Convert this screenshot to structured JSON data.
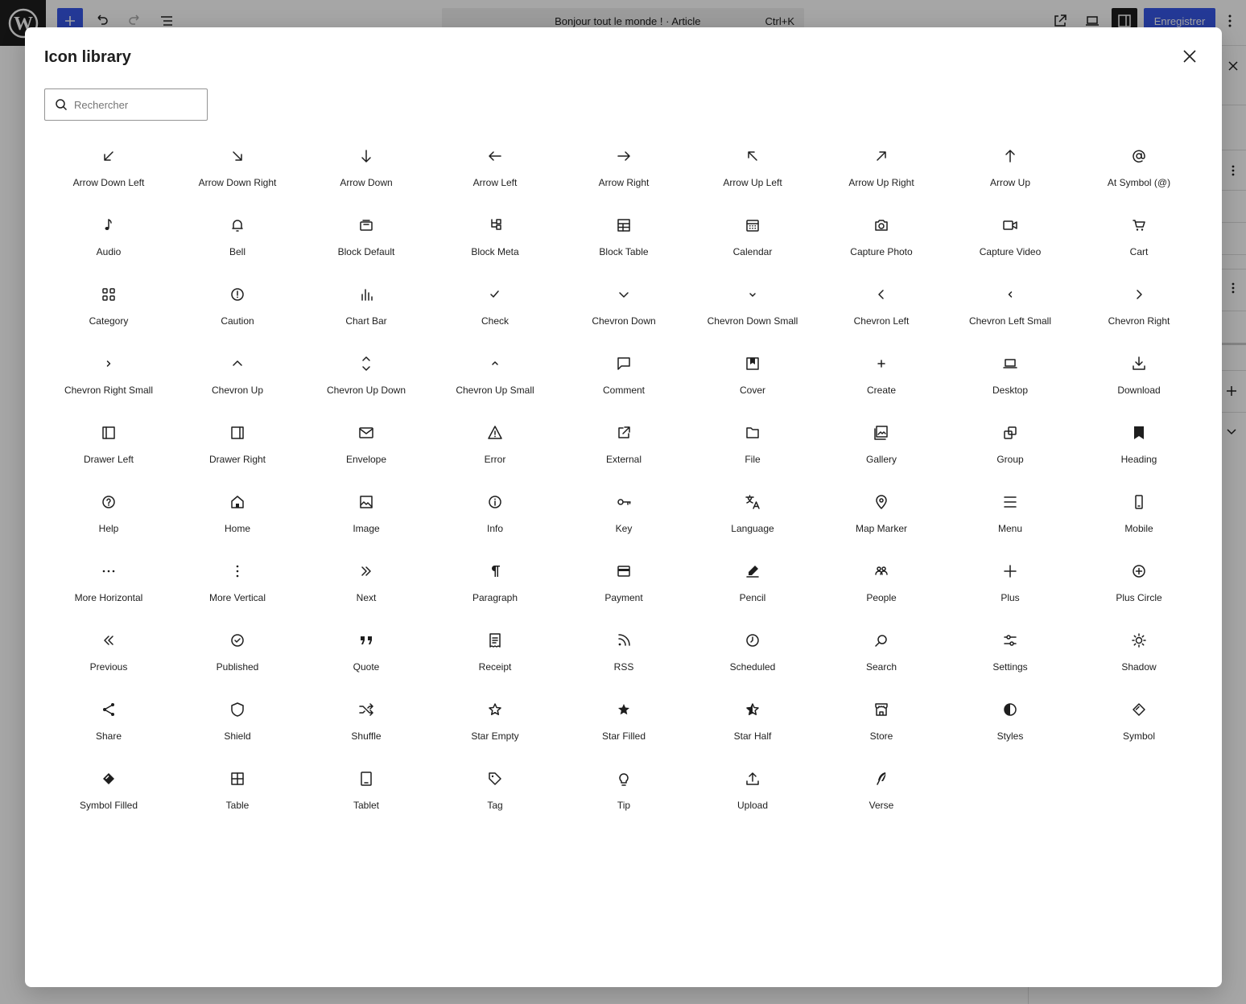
{
  "editor": {
    "document_title": "Bonjour tout le monde ! · Article",
    "shortcut": "Ctrl+K",
    "save_label": "Enregistrer"
  },
  "modal": {
    "title": "Icon library",
    "search": {
      "placeholder": "Rechercher",
      "value": ""
    }
  },
  "icons": [
    {
      "label": "Arrow Down Left",
      "icon": "arrow-down-left-icon"
    },
    {
      "label": "Arrow Down Right",
      "icon": "arrow-down-right-icon"
    },
    {
      "label": "Arrow Down",
      "icon": "arrow-down-icon"
    },
    {
      "label": "Arrow Left",
      "icon": "arrow-left-icon"
    },
    {
      "label": "Arrow Right",
      "icon": "arrow-right-icon"
    },
    {
      "label": "Arrow Up Left",
      "icon": "arrow-up-left-icon"
    },
    {
      "label": "Arrow Up Right",
      "icon": "arrow-up-right-icon"
    },
    {
      "label": "Arrow Up",
      "icon": "arrow-up-icon"
    },
    {
      "label": "At Symbol (@)",
      "icon": "at-symbol-icon"
    },
    {
      "label": "Audio",
      "icon": "audio-icon"
    },
    {
      "label": "Bell",
      "icon": "bell-icon"
    },
    {
      "label": "Block Default",
      "icon": "block-default-icon"
    },
    {
      "label": "Block Meta",
      "icon": "block-meta-icon"
    },
    {
      "label": "Block Table",
      "icon": "block-table-icon"
    },
    {
      "label": "Calendar",
      "icon": "calendar-icon"
    },
    {
      "label": "Capture Photo",
      "icon": "capture-photo-icon"
    },
    {
      "label": "Capture Video",
      "icon": "capture-video-icon"
    },
    {
      "label": "Cart",
      "icon": "cart-icon"
    },
    {
      "label": "Category",
      "icon": "category-icon"
    },
    {
      "label": "Caution",
      "icon": "caution-icon"
    },
    {
      "label": "Chart Bar",
      "icon": "chart-bar-icon"
    },
    {
      "label": "Check",
      "icon": "check-icon"
    },
    {
      "label": "Chevron Down",
      "icon": "chevron-down-icon"
    },
    {
      "label": "Chevron Down Small",
      "icon": "chevron-down-small-icon"
    },
    {
      "label": "Chevron Left",
      "icon": "chevron-left-icon"
    },
    {
      "label": "Chevron Left Small",
      "icon": "chevron-left-small-icon"
    },
    {
      "label": "Chevron Right",
      "icon": "chevron-right-icon"
    },
    {
      "label": "Chevron Right Small",
      "icon": "chevron-right-small-icon"
    },
    {
      "label": "Chevron Up",
      "icon": "chevron-up-icon"
    },
    {
      "label": "Chevron Up Down",
      "icon": "chevron-up-down-icon"
    },
    {
      "label": "Chevron Up Small",
      "icon": "chevron-up-small-icon"
    },
    {
      "label": "Comment",
      "icon": "comment-icon"
    },
    {
      "label": "Cover",
      "icon": "cover-icon"
    },
    {
      "label": "Create",
      "icon": "create-icon"
    },
    {
      "label": "Desktop",
      "icon": "desktop-icon"
    },
    {
      "label": "Download",
      "icon": "download-icon"
    },
    {
      "label": "Drawer Left",
      "icon": "drawer-left-icon"
    },
    {
      "label": "Drawer Right",
      "icon": "drawer-right-icon"
    },
    {
      "label": "Envelope",
      "icon": "envelope-icon"
    },
    {
      "label": "Error",
      "icon": "error-icon"
    },
    {
      "label": "External",
      "icon": "external-icon"
    },
    {
      "label": "File",
      "icon": "file-icon"
    },
    {
      "label": "Gallery",
      "icon": "gallery-icon"
    },
    {
      "label": "Group",
      "icon": "group-icon"
    },
    {
      "label": "Heading",
      "icon": "heading-icon"
    },
    {
      "label": "Help",
      "icon": "help-icon"
    },
    {
      "label": "Home",
      "icon": "home-icon"
    },
    {
      "label": "Image",
      "icon": "image-icon"
    },
    {
      "label": "Info",
      "icon": "info-icon"
    },
    {
      "label": "Key",
      "icon": "key-icon"
    },
    {
      "label": "Language",
      "icon": "language-icon"
    },
    {
      "label": "Map Marker",
      "icon": "map-marker-icon"
    },
    {
      "label": "Menu",
      "icon": "menu-icon"
    },
    {
      "label": "Mobile",
      "icon": "mobile-icon"
    },
    {
      "label": "More Horizontal",
      "icon": "more-horizontal-icon"
    },
    {
      "label": "More Vertical",
      "icon": "more-vertical-icon"
    },
    {
      "label": "Next",
      "icon": "next-icon"
    },
    {
      "label": "Paragraph",
      "icon": "paragraph-icon"
    },
    {
      "label": "Payment",
      "icon": "payment-icon"
    },
    {
      "label": "Pencil",
      "icon": "pencil-icon"
    },
    {
      "label": "People",
      "icon": "people-icon"
    },
    {
      "label": "Plus",
      "icon": "plus-icon"
    },
    {
      "label": "Plus Circle",
      "icon": "plus-circle-icon"
    },
    {
      "label": "Previous",
      "icon": "previous-icon"
    },
    {
      "label": "Published",
      "icon": "published-icon"
    },
    {
      "label": "Quote",
      "icon": "quote-icon"
    },
    {
      "label": "Receipt",
      "icon": "receipt-icon"
    },
    {
      "label": "RSS",
      "icon": "rss-icon"
    },
    {
      "label": "Scheduled",
      "icon": "scheduled-icon"
    },
    {
      "label": "Search",
      "icon": "search-icon"
    },
    {
      "label": "Settings",
      "icon": "settings-icon"
    },
    {
      "label": "Shadow",
      "icon": "shadow-icon"
    },
    {
      "label": "Share",
      "icon": "share-icon"
    },
    {
      "label": "Shield",
      "icon": "shield-icon"
    },
    {
      "label": "Shuffle",
      "icon": "shuffle-icon"
    },
    {
      "label": "Star Empty",
      "icon": "star-empty-icon"
    },
    {
      "label": "Star Filled",
      "icon": "star-filled-icon"
    },
    {
      "label": "Star Half",
      "icon": "star-half-icon"
    },
    {
      "label": "Store",
      "icon": "store-icon"
    },
    {
      "label": "Styles",
      "icon": "styles-icon"
    },
    {
      "label": "Symbol",
      "icon": "symbol-icon"
    },
    {
      "label": "Symbol Filled",
      "icon": "symbol-filled-icon"
    },
    {
      "label": "Table",
      "icon": "table-icon"
    },
    {
      "label": "Tablet",
      "icon": "tablet-icon"
    },
    {
      "label": "Tag",
      "icon": "tag-icon"
    },
    {
      "label": "Tip",
      "icon": "tip-icon"
    },
    {
      "label": "Upload",
      "icon": "upload-icon"
    },
    {
      "label": "Verse",
      "icon": "verse-icon"
    }
  ],
  "colors": {
    "accent": "#3858e9",
    "text": "#1e1e1e",
    "overlay": "rgba(0,0,0,0.35)"
  }
}
